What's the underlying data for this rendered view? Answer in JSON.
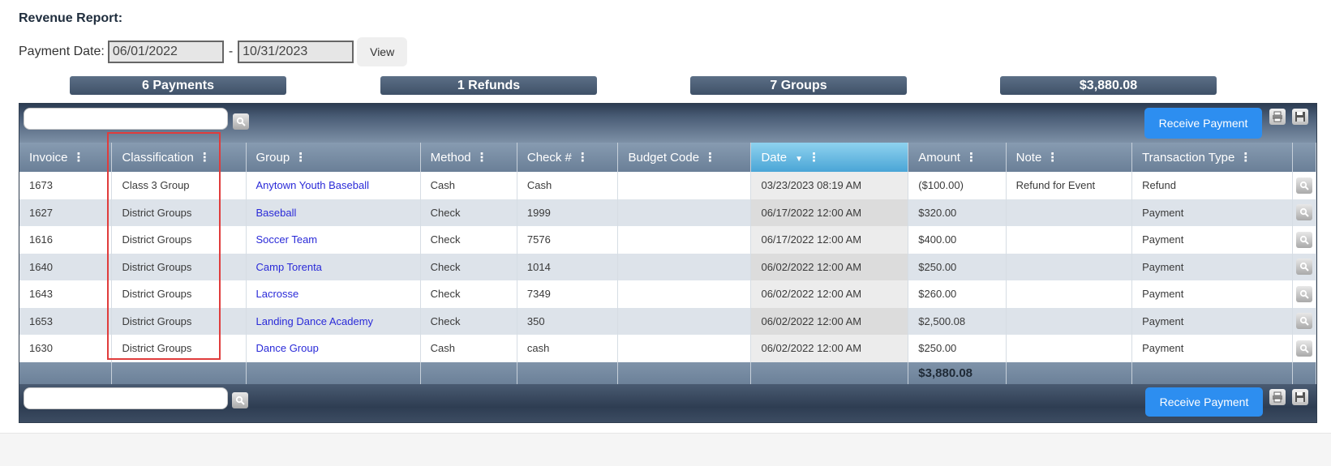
{
  "report": {
    "title": "Revenue Report:",
    "payment_date_label": "Payment Date:",
    "date_from": "06/01/2022",
    "date_separator": "-",
    "date_to": "10/31/2023",
    "view_label": "View"
  },
  "summary": {
    "payments": "6 Payments",
    "refunds": "1 Refunds",
    "groups": "7 Groups",
    "total": "$3,880.08"
  },
  "toolbar": {
    "search_placeholder": "",
    "receive_payment_label": "Receive Payment"
  },
  "table": {
    "columns": [
      "Invoice",
      "Classification",
      "Group",
      "Method",
      "Check #",
      "Budget Code",
      "Date",
      "Amount",
      "Note",
      "Transaction Type"
    ],
    "sorted_column": "Date",
    "rows": [
      {
        "invoice": "1673",
        "classification": "Class 3 Group",
        "group": "Anytown Youth Baseball",
        "method": "Cash",
        "check": "Cash",
        "budget_code": "",
        "date": "03/23/2023 08:19 AM",
        "amount": "($100.00)",
        "note": "Refund for Event",
        "type": "Refund"
      },
      {
        "invoice": "1627",
        "classification": "District Groups",
        "group": "Baseball",
        "method": "Check",
        "check": "1999",
        "budget_code": "",
        "date": "06/17/2022 12:00 AM",
        "amount": "$320.00",
        "note": "",
        "type": "Payment"
      },
      {
        "invoice": "1616",
        "classification": "District Groups",
        "group": "Soccer Team",
        "method": "Check",
        "check": "7576",
        "budget_code": "",
        "date": "06/17/2022 12:00 AM",
        "amount": "$400.00",
        "note": "",
        "type": "Payment"
      },
      {
        "invoice": "1640",
        "classification": "District Groups",
        "group": "Camp Torenta",
        "method": "Check",
        "check": "1014",
        "budget_code": "",
        "date": "06/02/2022 12:00 AM",
        "amount": "$250.00",
        "note": "",
        "type": "Payment"
      },
      {
        "invoice": "1643",
        "classification": "District Groups",
        "group": "Lacrosse",
        "method": "Check",
        "check": "7349",
        "budget_code": "",
        "date": "06/02/2022 12:00 AM",
        "amount": "$260.00",
        "note": "",
        "type": "Payment"
      },
      {
        "invoice": "1653",
        "classification": "District Groups",
        "group": "Landing Dance Academy",
        "method": "Check",
        "check": "350",
        "budget_code": "",
        "date": "06/02/2022 12:00 AM",
        "amount": "$2,500.08",
        "note": "",
        "type": "Payment"
      },
      {
        "invoice": "1630",
        "classification": "District Groups",
        "group": "Dance Group",
        "method": "Cash",
        "check": "cash",
        "budget_code": "",
        "date": "06/02/2022 12:00 AM",
        "amount": "$250.00",
        "note": "",
        "type": "Payment"
      }
    ],
    "total_amount": "$3,880.08"
  },
  "icons": {
    "search": "magnifier-icon",
    "print": "printer-icon",
    "save": "floppy-disk-icon",
    "column_menu": "kebab-menu-icon",
    "sort": "sort-descending-icon"
  },
  "colors": {
    "accent_button": "#2d8ef0",
    "header": "#6a7f97",
    "sorted_header": "#4aa5d6",
    "link": "#2a2ad8",
    "highlight": "#e03c3c"
  }
}
